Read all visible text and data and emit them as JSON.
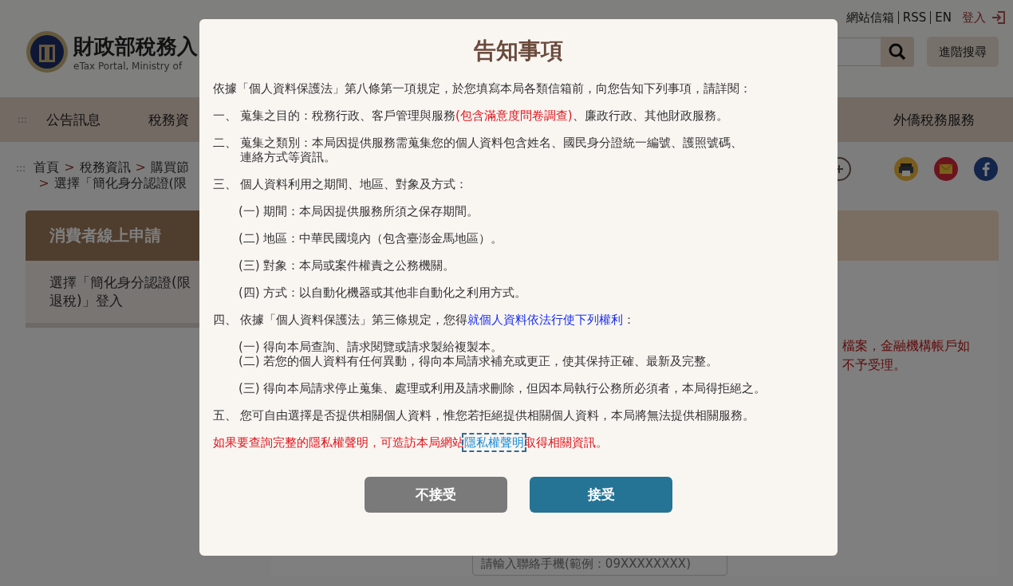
{
  "header": {
    "links": [
      {
        "label": "網站信箱"
      },
      {
        "label": "RSS"
      },
      {
        "label": "EN"
      }
    ],
    "login": "登入",
    "logo_title": "財政部稅務入",
    "logo_subtitle": "eTax Portal, Ministry of",
    "advanced_search": "進階搜尋"
  },
  "nav": {
    "accesskey": ":::",
    "items": [
      {
        "label": "公告訊息"
      },
      {
        "label": "稅務資"
      },
      {
        "label": "外僑稅務服務"
      }
    ]
  },
  "breadcrumb": {
    "accesskey": ":::",
    "separator": ">",
    "items": [
      "首頁",
      "稅務資訊",
      "購買節",
      "選擇「簡化身分認證(限"
    ]
  },
  "sidebar": {
    "title": "消費者線上申請",
    "items": [
      {
        "lines": [
          "選擇「簡化身分認證(限",
          "退稅)」登入"
        ]
      }
    ]
  },
  "main": {
    "notice_lines": [
      "檔案，金融機構帳戶如",
      "不予受理。"
    ],
    "phone_field": {
      "placeholder": "請輸入聯絡手機(範例：09XXXXXXXX)"
    }
  },
  "modal": {
    "title": "告知事項",
    "paragraphs": [
      {
        "kind": "intro",
        "lines": [
          [
            {
              "text": "依據「個人資料保護法」第八條第一項規定，於您填寫本局各類信箱前，向您告知下列事項，請詳閱：",
              "kind": "plain"
            }
          ]
        ]
      },
      {
        "kind": "item",
        "marker": "一、",
        "lines": [
          [
            {
              "text": "蒐集之目的：稅務行政、客戶管理與服務",
              "kind": "plain"
            },
            {
              "text": "(包含滿意度問卷調查)",
              "kind": "red"
            },
            {
              "text": "、廉政行政、其他財政服務。",
              "kind": "plain"
            }
          ]
        ]
      },
      {
        "kind": "item",
        "marker": "二、",
        "lines": [
          [
            {
              "text": "蒐集之類別：本局因提供服務需蒐集您的個人資料包含姓名、國民身分證統一編號、護照號碼、",
              "kind": "plain"
            }
          ],
          [
            {
              "text": "連絡方式等資訊。",
              "kind": "plain"
            }
          ]
        ]
      },
      {
        "kind": "item",
        "marker": "三、",
        "lines": [
          [
            {
              "text": "個人資料利用之期間、地區、對象及方式：",
              "kind": "plain"
            }
          ]
        ]
      },
      {
        "kind": "sub",
        "lines": [
          [
            {
              "text": "(一) 期間：本局因提供服務所須之保存期間。",
              "kind": "plain"
            }
          ]
        ]
      },
      {
        "kind": "sub",
        "lines": [
          [
            {
              "text": "(二) 地區：中華民國境內（包含臺澎金馬地區）。",
              "kind": "plain"
            }
          ]
        ]
      },
      {
        "kind": "sub",
        "lines": [
          [
            {
              "text": "(三) 對象：本局或案件權責之公務機關。",
              "kind": "plain"
            }
          ]
        ]
      },
      {
        "kind": "sub",
        "lines": [
          [
            {
              "text": "(四) 方式：以自動化機器或其他非自動化之利用方式。",
              "kind": "plain"
            }
          ]
        ]
      },
      {
        "kind": "item",
        "marker": "四、",
        "lines": [
          [
            {
              "text": "依據「個人資料保護法」第三條規定，您得",
              "kind": "plain"
            },
            {
              "text": "就個人資料依法行使下列權利",
              "kind": "blue"
            },
            {
              "text": "：",
              "kind": "plain"
            }
          ]
        ]
      },
      {
        "kind": "sub",
        "lines": [
          [
            {
              "text": "(一) 得向本局查詢、請求閱覽或請求製給複製本。",
              "kind": "plain"
            }
          ],
          [
            {
              "text": "(二) 若您的個人資料有任何異動，得向本局請求補充或更正，使其保持正確、最新及完整。",
              "kind": "plain"
            }
          ]
        ]
      },
      {
        "kind": "sub",
        "lines": [
          [
            {
              "text": "(三) 得向本局請求停止蒐集、處理或利用及請求刪除，但因本局執行公務所必須者，本局得拒絕之。",
              "kind": "plain"
            }
          ]
        ]
      },
      {
        "kind": "item",
        "marker": "五、",
        "lines": [
          [
            {
              "text": "您可自由選擇是否提供相關個人資料，惟您若拒絕提供相關個人資料，本局將無法提供相關服務。",
              "kind": "plain"
            }
          ]
        ]
      },
      {
        "kind": "note",
        "lines": [
          [
            {
              "text": "如果要查詢完整的隱私權聲明，可造訪本局網站",
              "kind": "red"
            },
            {
              "text": "隱私權聲明",
              "kind": "link"
            },
            {
              "text": "取得相關資訊。",
              "kind": "red"
            }
          ]
        ]
      }
    ],
    "buttons": [
      {
        "label": "不接受",
        "kind": "decline"
      },
      {
        "label": "接受",
        "kind": "accept"
      }
    ]
  }
}
